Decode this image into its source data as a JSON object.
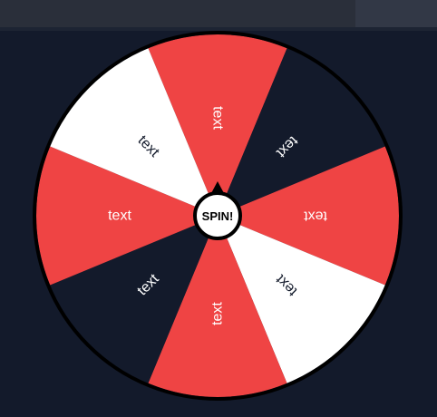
{
  "wheel": {
    "spin_label": "SPIN!",
    "segments": [
      {
        "label": "text",
        "color": "#ef4444",
        "text_color": "#ffffff"
      },
      {
        "label": "text",
        "color": "#131a2b",
        "text_color": "#ffffff"
      },
      {
        "label": "text",
        "color": "#ef4444",
        "text_color": "#ffffff"
      },
      {
        "label": "text",
        "color": "#ffffff",
        "text_color": "#131a2b"
      },
      {
        "label": "text",
        "color": "#ef4444",
        "text_color": "#ffffff"
      },
      {
        "label": "text",
        "color": "#131a2b",
        "text_color": "#ffffff"
      },
      {
        "label": "text",
        "color": "#ef4444",
        "text_color": "#ffffff"
      },
      {
        "label": "text",
        "color": "#ffffff",
        "text_color": "#131a2b"
      }
    ],
    "rim_color": "#000000",
    "hub_color": "#ffffff"
  }
}
